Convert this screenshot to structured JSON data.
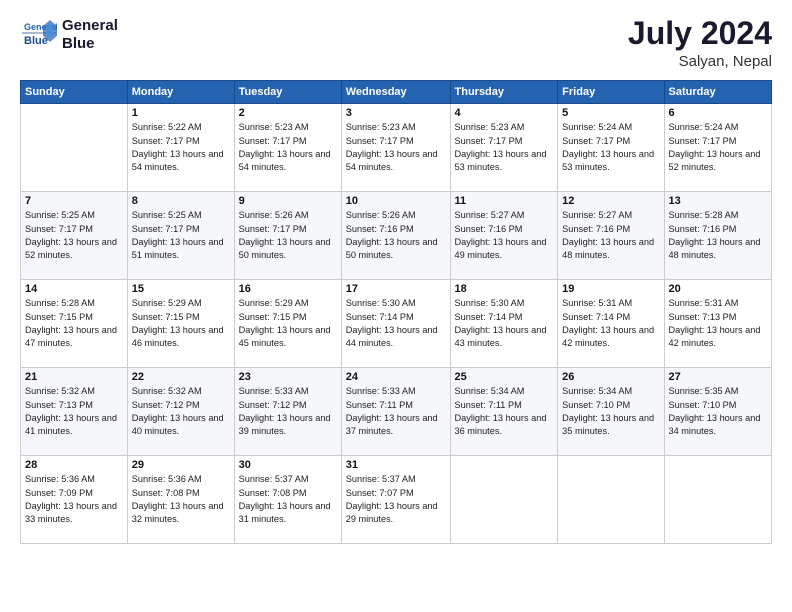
{
  "header": {
    "logo_line1": "General",
    "logo_line2": "Blue",
    "month_year": "July 2024",
    "location": "Salyan, Nepal"
  },
  "weekdays": [
    "Sunday",
    "Monday",
    "Tuesday",
    "Wednesday",
    "Thursday",
    "Friday",
    "Saturday"
  ],
  "weeks": [
    [
      {
        "day": "",
        "sunrise": "",
        "sunset": "",
        "daylight": ""
      },
      {
        "day": "1",
        "sunrise": "Sunrise: 5:22 AM",
        "sunset": "Sunset: 7:17 PM",
        "daylight": "Daylight: 13 hours and 54 minutes."
      },
      {
        "day": "2",
        "sunrise": "Sunrise: 5:23 AM",
        "sunset": "Sunset: 7:17 PM",
        "daylight": "Daylight: 13 hours and 54 minutes."
      },
      {
        "day": "3",
        "sunrise": "Sunrise: 5:23 AM",
        "sunset": "Sunset: 7:17 PM",
        "daylight": "Daylight: 13 hours and 54 minutes."
      },
      {
        "day": "4",
        "sunrise": "Sunrise: 5:23 AM",
        "sunset": "Sunset: 7:17 PM",
        "daylight": "Daylight: 13 hours and 53 minutes."
      },
      {
        "day": "5",
        "sunrise": "Sunrise: 5:24 AM",
        "sunset": "Sunset: 7:17 PM",
        "daylight": "Daylight: 13 hours and 53 minutes."
      },
      {
        "day": "6",
        "sunrise": "Sunrise: 5:24 AM",
        "sunset": "Sunset: 7:17 PM",
        "daylight": "Daylight: 13 hours and 52 minutes."
      }
    ],
    [
      {
        "day": "7",
        "sunrise": "Sunrise: 5:25 AM",
        "sunset": "Sunset: 7:17 PM",
        "daylight": "Daylight: 13 hours and 52 minutes."
      },
      {
        "day": "8",
        "sunrise": "Sunrise: 5:25 AM",
        "sunset": "Sunset: 7:17 PM",
        "daylight": "Daylight: 13 hours and 51 minutes."
      },
      {
        "day": "9",
        "sunrise": "Sunrise: 5:26 AM",
        "sunset": "Sunset: 7:17 PM",
        "daylight": "Daylight: 13 hours and 50 minutes."
      },
      {
        "day": "10",
        "sunrise": "Sunrise: 5:26 AM",
        "sunset": "Sunset: 7:16 PM",
        "daylight": "Daylight: 13 hours and 50 minutes."
      },
      {
        "day": "11",
        "sunrise": "Sunrise: 5:27 AM",
        "sunset": "Sunset: 7:16 PM",
        "daylight": "Daylight: 13 hours and 49 minutes."
      },
      {
        "day": "12",
        "sunrise": "Sunrise: 5:27 AM",
        "sunset": "Sunset: 7:16 PM",
        "daylight": "Daylight: 13 hours and 48 minutes."
      },
      {
        "day": "13",
        "sunrise": "Sunrise: 5:28 AM",
        "sunset": "Sunset: 7:16 PM",
        "daylight": "Daylight: 13 hours and 48 minutes."
      }
    ],
    [
      {
        "day": "14",
        "sunrise": "Sunrise: 5:28 AM",
        "sunset": "Sunset: 7:15 PM",
        "daylight": "Daylight: 13 hours and 47 minutes."
      },
      {
        "day": "15",
        "sunrise": "Sunrise: 5:29 AM",
        "sunset": "Sunset: 7:15 PM",
        "daylight": "Daylight: 13 hours and 46 minutes."
      },
      {
        "day": "16",
        "sunrise": "Sunrise: 5:29 AM",
        "sunset": "Sunset: 7:15 PM",
        "daylight": "Daylight: 13 hours and 45 minutes."
      },
      {
        "day": "17",
        "sunrise": "Sunrise: 5:30 AM",
        "sunset": "Sunset: 7:14 PM",
        "daylight": "Daylight: 13 hours and 44 minutes."
      },
      {
        "day": "18",
        "sunrise": "Sunrise: 5:30 AM",
        "sunset": "Sunset: 7:14 PM",
        "daylight": "Daylight: 13 hours and 43 minutes."
      },
      {
        "day": "19",
        "sunrise": "Sunrise: 5:31 AM",
        "sunset": "Sunset: 7:14 PM",
        "daylight": "Daylight: 13 hours and 42 minutes."
      },
      {
        "day": "20",
        "sunrise": "Sunrise: 5:31 AM",
        "sunset": "Sunset: 7:13 PM",
        "daylight": "Daylight: 13 hours and 42 minutes."
      }
    ],
    [
      {
        "day": "21",
        "sunrise": "Sunrise: 5:32 AM",
        "sunset": "Sunset: 7:13 PM",
        "daylight": "Daylight: 13 hours and 41 minutes."
      },
      {
        "day": "22",
        "sunrise": "Sunrise: 5:32 AM",
        "sunset": "Sunset: 7:12 PM",
        "daylight": "Daylight: 13 hours and 40 minutes."
      },
      {
        "day": "23",
        "sunrise": "Sunrise: 5:33 AM",
        "sunset": "Sunset: 7:12 PM",
        "daylight": "Daylight: 13 hours and 39 minutes."
      },
      {
        "day": "24",
        "sunrise": "Sunrise: 5:33 AM",
        "sunset": "Sunset: 7:11 PM",
        "daylight": "Daylight: 13 hours and 37 minutes."
      },
      {
        "day": "25",
        "sunrise": "Sunrise: 5:34 AM",
        "sunset": "Sunset: 7:11 PM",
        "daylight": "Daylight: 13 hours and 36 minutes."
      },
      {
        "day": "26",
        "sunrise": "Sunrise: 5:34 AM",
        "sunset": "Sunset: 7:10 PM",
        "daylight": "Daylight: 13 hours and 35 minutes."
      },
      {
        "day": "27",
        "sunrise": "Sunrise: 5:35 AM",
        "sunset": "Sunset: 7:10 PM",
        "daylight": "Daylight: 13 hours and 34 minutes."
      }
    ],
    [
      {
        "day": "28",
        "sunrise": "Sunrise: 5:36 AM",
        "sunset": "Sunset: 7:09 PM",
        "daylight": "Daylight: 13 hours and 33 minutes."
      },
      {
        "day": "29",
        "sunrise": "Sunrise: 5:36 AM",
        "sunset": "Sunset: 7:08 PM",
        "daylight": "Daylight: 13 hours and 32 minutes."
      },
      {
        "day": "30",
        "sunrise": "Sunrise: 5:37 AM",
        "sunset": "Sunset: 7:08 PM",
        "daylight": "Daylight: 13 hours and 31 minutes."
      },
      {
        "day": "31",
        "sunrise": "Sunrise: 5:37 AM",
        "sunset": "Sunset: 7:07 PM",
        "daylight": "Daylight: 13 hours and 29 minutes."
      },
      {
        "day": "",
        "sunrise": "",
        "sunset": "",
        "daylight": ""
      },
      {
        "day": "",
        "sunrise": "",
        "sunset": "",
        "daylight": ""
      },
      {
        "day": "",
        "sunrise": "",
        "sunset": "",
        "daylight": ""
      }
    ]
  ]
}
